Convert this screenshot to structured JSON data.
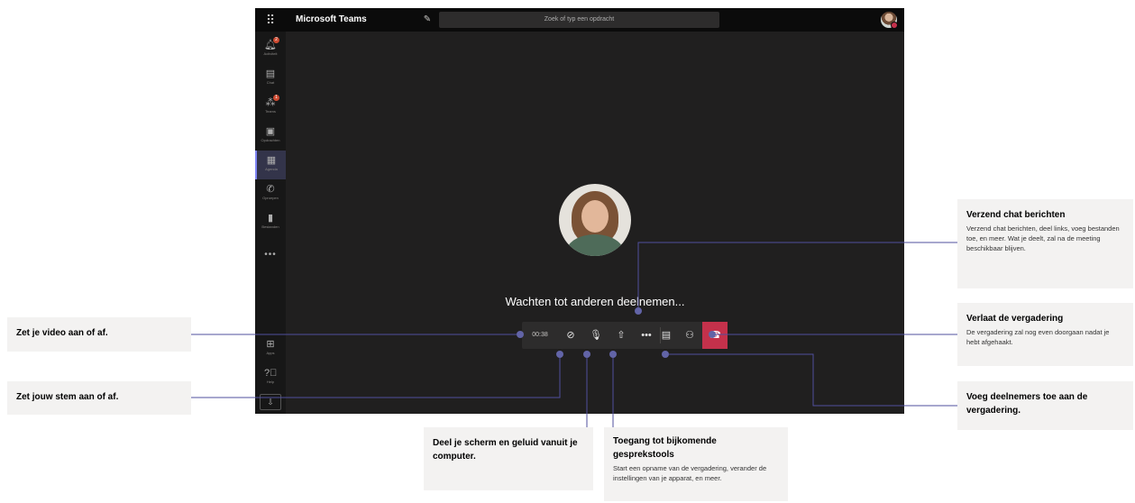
{
  "teams": {
    "title": "Microsoft Teams",
    "search_placeholder": "Zoek of typ een opdracht",
    "rail": [
      {
        "label": "Activiteit",
        "icon": "bell-icon",
        "badge": "2"
      },
      {
        "label": "Chat",
        "icon": "chat-icon"
      },
      {
        "label": "Teams",
        "icon": "teams-icon",
        "badge": "1"
      },
      {
        "label": "Opdrachten",
        "icon": "assignments-icon"
      },
      {
        "label": "Agenda",
        "icon": "calendar-icon",
        "active": true
      },
      {
        "label": "Oproepen",
        "icon": "phone-icon"
      },
      {
        "label": "Bestanden",
        "icon": "files-icon"
      },
      {
        "label": "Apps",
        "icon": "apps-icon"
      },
      {
        "label": "Help",
        "icon": "help-icon"
      }
    ],
    "more": "•••",
    "meeting": {
      "waiting_text": "Wachten tot anderen deelnemen...",
      "timer": "00:38",
      "controls": [
        "camera-off-icon",
        "mic-off-icon",
        "share-screen-icon",
        "more-options-icon",
        "chat-icon",
        "participants-icon",
        "hang-up-icon"
      ]
    },
    "colors": {
      "accent": "#7f85f5",
      "hangup": "#c4314b",
      "stage": "#201f1f"
    }
  },
  "callouts": {
    "video": {
      "title": "Zet je video aan of af."
    },
    "voice": {
      "title": "Zet jouw stem aan of af."
    },
    "share": {
      "title": "Deel je scherm en geluid vanuit je computer."
    },
    "tools": {
      "title": "Toegang tot bijkomende gesprekstools",
      "desc": "Start een opname van de vergadering, verander de instellingen van je apparat, en meer."
    },
    "chat": {
      "title": "Verzend chat berichten",
      "desc": "Verzend chat berichten, deel links, voeg bestanden toe, en meer. Wat je deelt, zal na de meeting beschikbaar blijven."
    },
    "leave": {
      "title": "Verlaat de vergadering",
      "desc": "De vergadering zal nog even doorgaan nadat je hebt afgehaakt."
    },
    "add": {
      "title": "Voeg deelnemers toe aan de vergadering."
    }
  }
}
